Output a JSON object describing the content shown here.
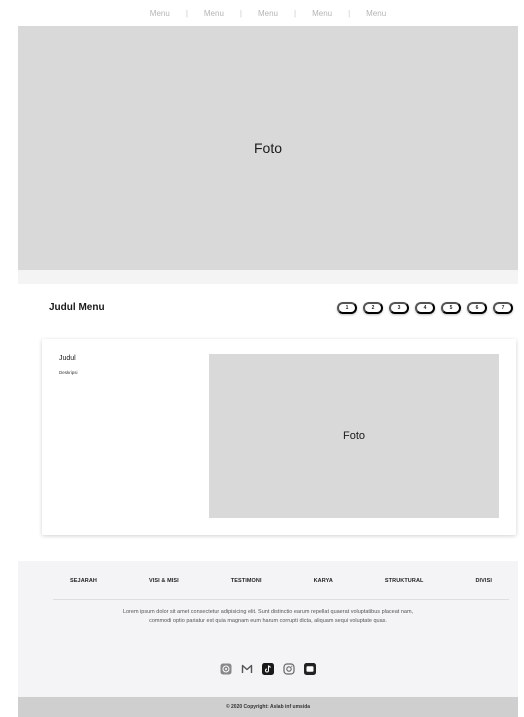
{
  "topnav": {
    "items": [
      "Menu",
      "Menu",
      "Menu",
      "Menu",
      "Menu"
    ],
    "separator": "|"
  },
  "hero": {
    "label": "Foto"
  },
  "section": {
    "title": "Judul Menu",
    "pages": [
      "1",
      "2",
      "3",
      "4",
      "5",
      "6",
      "7"
    ]
  },
  "card": {
    "title": "Judul",
    "description": "Deskripsi",
    "photo_label": "Foto"
  },
  "footer": {
    "links": [
      "SEJARAH",
      "VISI & MISI",
      "TESTIMONI",
      "KARYA",
      "STRUKTURAL",
      "DIVISI"
    ],
    "about": "Lorem ipsum dolor sit amet consectetur adipisicing elit. Sunt distinctio earum repellat quaerat voluptatibus placeat nam, commodi optio pariatur est quia magnam eum harum corrupti dicta, aliquam sequi voluptate quas.",
    "socials": [
      "whatsapp-icon",
      "gmail-icon",
      "tiktok-icon",
      "instagram-icon",
      "youtube-icon"
    ],
    "copyright": "© 2020 Copyright: Aslab inf umsida"
  },
  "colors": {
    "placeholder": "#d9d9d9",
    "footer_bg": "#f4f4f6",
    "copyright_bg": "#cfcfcf"
  }
}
